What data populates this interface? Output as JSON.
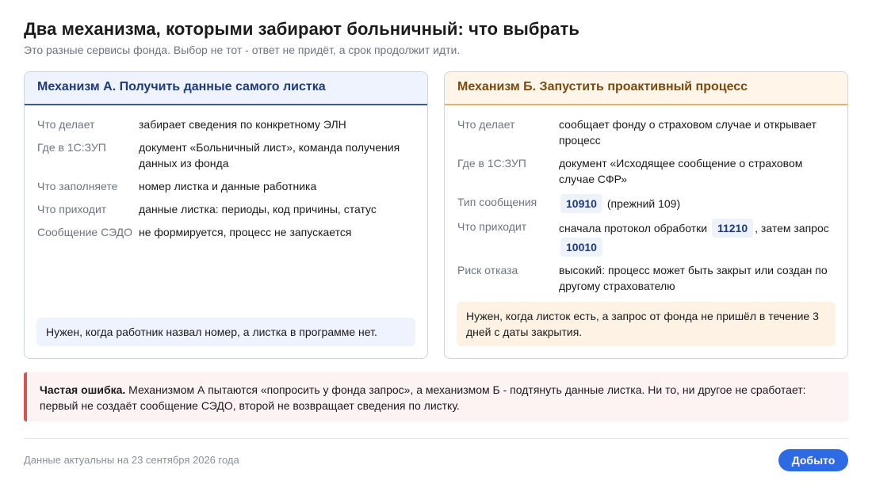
{
  "header": {
    "title": "Два механизма, которыми забирают больничный: что выбрать",
    "subtitle": "Это разные сервисы фонда. Выбор не тот - ответ не придёт, а срок продолжит идти."
  },
  "colors": {
    "accent_blue": "#2f6ae5",
    "card_a_header": "#eef3fe",
    "card_b_header": "#fff6e9",
    "error_border": "#d9534f"
  },
  "card_a": {
    "title": "Механизм А. Получить данные самого листка",
    "rows": [
      {
        "key": "Что делает",
        "value": "забирает сведения по конкретному ЭЛН"
      },
      {
        "key": "Где в 1С:ЗУП",
        "value": "документ «Больничный лист», команда получения данных из фонда"
      },
      {
        "key": "Что заполняете",
        "value": "номер листка и данные работника"
      },
      {
        "key": "Что приходит",
        "value": "данные листка: периоды, код причины, статус"
      },
      {
        "key": "Сообщение СЭДО",
        "value": "не формируется, процесс не запускается"
      }
    ],
    "note": "Нужен, когда работник назвал номер, а листка в программе нет."
  },
  "card_b": {
    "title": "Механизм Б. Запустить проактивный процесс",
    "rows": {
      "what_key": "Что делает",
      "what_value": "сообщает фонду о страховом случае и открывает процесс",
      "where_key": "Где в 1С:ЗУП",
      "where_value": "документ «Исходящее сообщение о страховом случае СФР»",
      "type_key": "Тип сообщения",
      "type_code": "10910",
      "type_suffix": "(прежний 109)",
      "comes_key": "Что приходит",
      "comes_prefix": "сначала протокол обработки",
      "comes_code1": "11210",
      "comes_mid": ", затем запрос",
      "comes_code2": "10010",
      "risk_key": "Риск отказа",
      "risk_value": "высокий: процесс может быть закрыт или создан по другому страхователю"
    },
    "note": "Нужен, когда листок есть, а запрос от фонда не пришёл в течение 3 дней с даты закрытия."
  },
  "error": {
    "label": "Частая ошибка.",
    "text": " Механизмом А пытаются «попросить у фонда запрос», а механизмом Б - подтянуть данные листка. Ни то, ни другое не сработает: первый не создаёт сообщение СЭДО, второй не возвращает сведения по листку."
  },
  "footer": {
    "date_text": "Данные актуальны на 23 сентября 2026 года",
    "done_label": "Добыто"
  }
}
